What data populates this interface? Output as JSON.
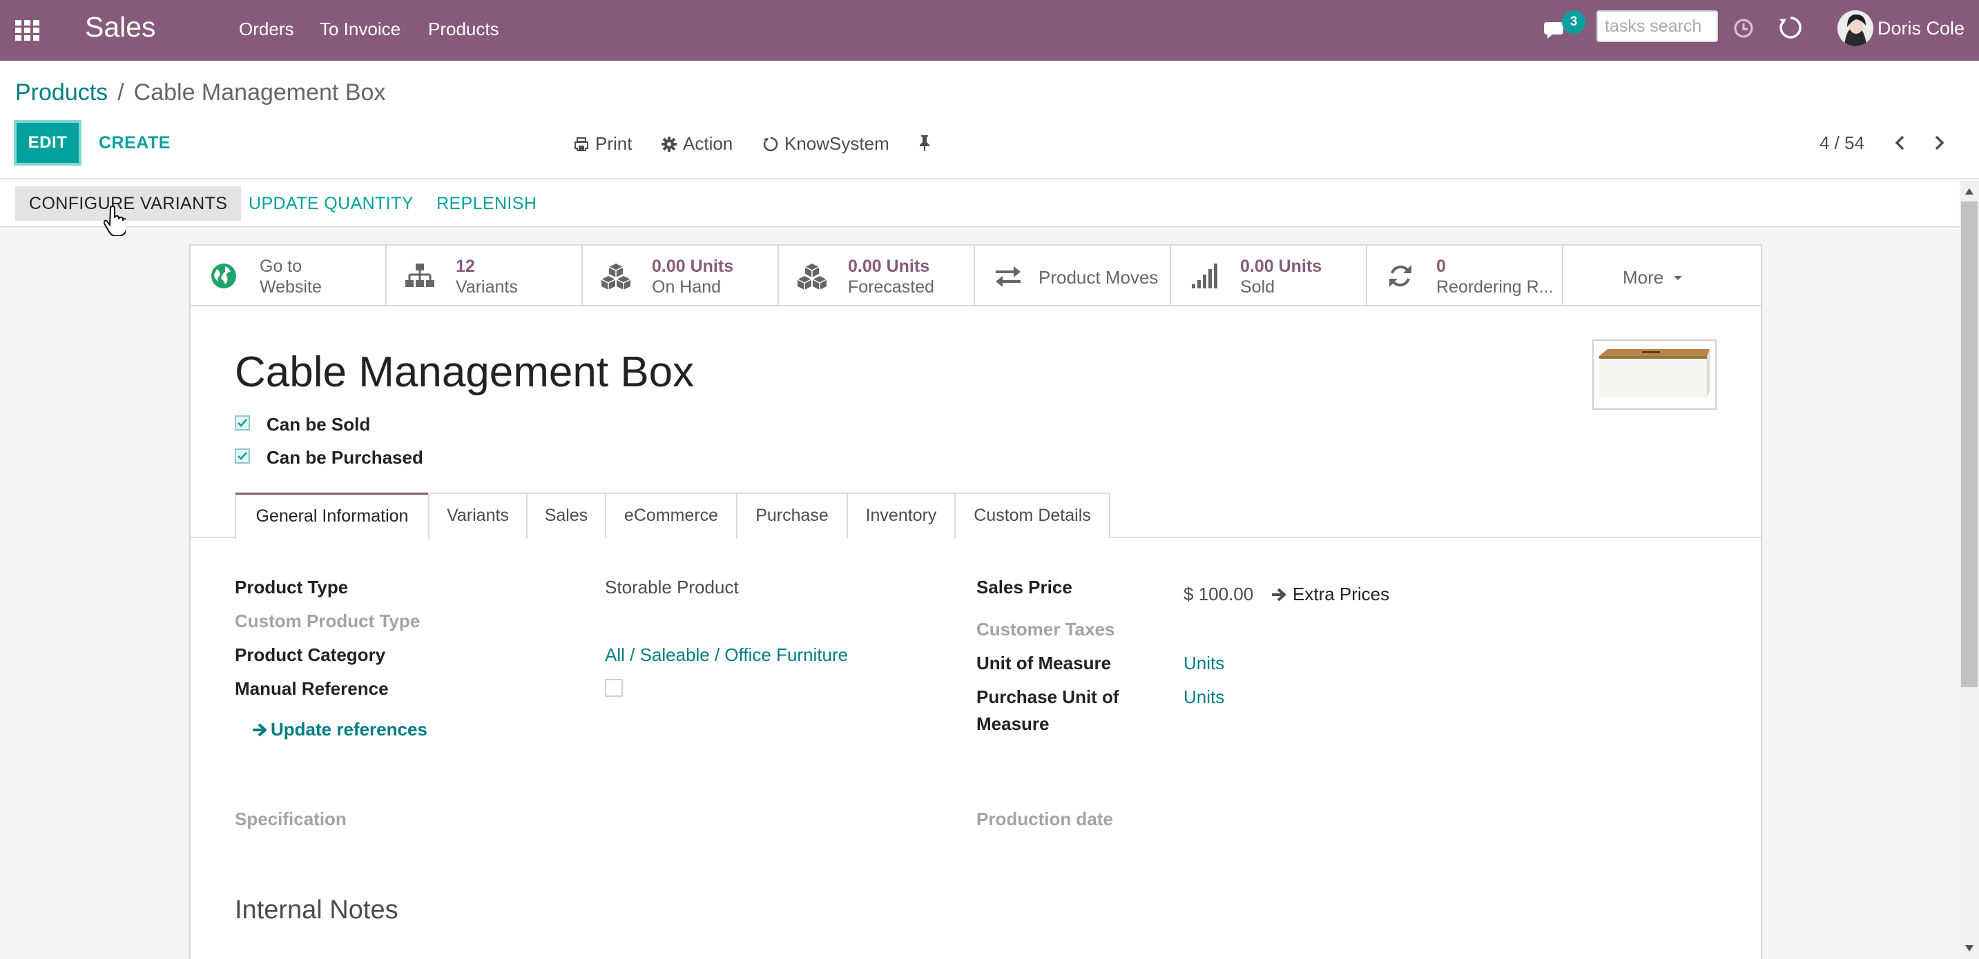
{
  "navbar": {
    "app_title": "Sales",
    "menus": [
      "Orders",
      "To Invoice",
      "Products"
    ],
    "message_count": "3",
    "search_placeholder": "tasks search",
    "user_name": "Doris Cole",
    "bg_color": "#875A7B"
  },
  "breadcrumb": {
    "parent": "Products",
    "separator": "/",
    "current": "Cable Management Box"
  },
  "control_panel": {
    "edit_label": "EDIT",
    "create_label": "CREATE",
    "print_label": "Print",
    "action_label": "Action",
    "knowsystem_label": "KnowSystem",
    "pager": "4 / 54"
  },
  "statusbar": {
    "configure_variants": "CONFIGURE VARIANTS",
    "update_quantity": "UPDATE QUANTITY",
    "replenish": "REPLENISH"
  },
  "smart_buttons": {
    "website": {
      "line1": "Go to",
      "line2": "Website",
      "icon": "globe-icon"
    },
    "variants": {
      "value": "12",
      "label": "Variants",
      "icon": "sitemap-icon"
    },
    "on_hand": {
      "value": "0.00 Units",
      "label": "On Hand",
      "icon": "cubes-icon"
    },
    "forecasted": {
      "value": "0.00 Units",
      "label": "Forecasted",
      "icon": "cubes-icon"
    },
    "moves": {
      "label": "Product Moves",
      "icon": "exchange-icon"
    },
    "sold": {
      "value": "0.00 Units",
      "label": "Sold",
      "icon": "signal-icon"
    },
    "reordering": {
      "value": "0",
      "label": "Reordering R...",
      "icon": "refresh-icon"
    },
    "more": {
      "label": "More"
    }
  },
  "product": {
    "name": "Cable Management Box",
    "can_be_sold_label": "Can be Sold",
    "can_be_purchased_label": "Can be Purchased",
    "can_be_sold": true,
    "can_be_purchased": true
  },
  "tabs": [
    "General Information",
    "Variants",
    "Sales",
    "eCommerce",
    "Purchase",
    "Inventory",
    "Custom Details"
  ],
  "general_info": {
    "left": {
      "product_type_label": "Product Type",
      "product_type_value": "Storable Product",
      "custom_type_label": "Custom Product Type",
      "category_label": "Product Category",
      "category_value": "All / Saleable / Office Furniture",
      "manual_ref_label": "Manual Reference",
      "update_refs_label": "Update references",
      "specification_label": "Specification"
    },
    "right": {
      "sales_price_label": "Sales Price",
      "sales_price_value": "$ 100.00",
      "extra_prices_label": "Extra Prices",
      "customer_taxes_label": "Customer Taxes",
      "uom_label": "Unit of Measure",
      "uom_value": "Units",
      "purchase_uom_label_1": "Purchase Unit of",
      "purchase_uom_label_2": "Measure",
      "purchase_uom_value": "Units",
      "production_date_label": "Production date"
    }
  },
  "internal_notes_title": "Internal Notes",
  "colors": {
    "primary": "#875A7B",
    "accent": "#00A09D",
    "link": "#017e84"
  }
}
